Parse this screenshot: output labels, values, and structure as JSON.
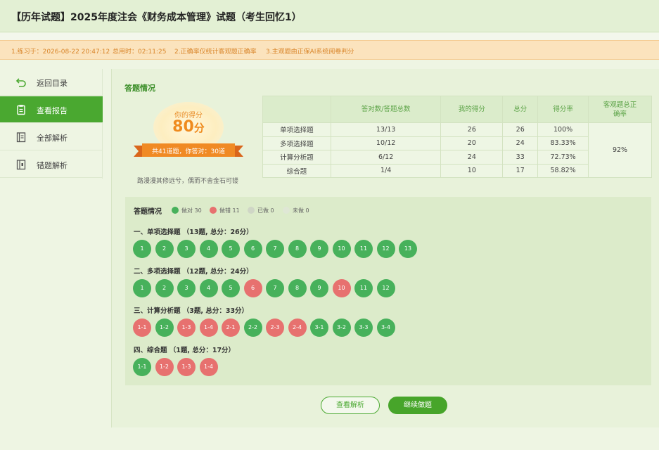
{
  "page": {
    "title": "【历年试题】2025年度注会《财务成本管理》试题（考生回忆1）"
  },
  "info_bar": {
    "practice_time": "1.练习于：2026-08-22 20:47:12",
    "total_time": "总用时：02:11:25",
    "note_accuracy": "2.正确率仅统计客观题正确率",
    "note_grading": "3.主观题由正保AI系统阅卷判分"
  },
  "sidebar": {
    "items": [
      {
        "label": "返回目录",
        "icon": "back-arrow-icon"
      },
      {
        "label": "查看报告",
        "icon": "clipboard-icon",
        "active": true
      },
      {
        "label": "全部解析",
        "icon": "book-icon"
      },
      {
        "label": "错题解析",
        "icon": "notebook-icon"
      }
    ]
  },
  "summary": {
    "section_title": "答题情况",
    "score_caption": "你的得分",
    "score_value": "80",
    "score_unit": "分",
    "score_detail": "共41道题，你答对：30道",
    "motto": "路漫漫其修远兮，偶而不舍金石可镂"
  },
  "stats_table": {
    "headers": [
      "",
      "答对数/答题总数",
      "我的得分",
      "总分",
      "得分率",
      "客观题总正确率"
    ],
    "rows": [
      [
        "单项选择题",
        "13/13",
        "26",
        "26",
        "100%"
      ],
      [
        "多项选择题",
        "10/12",
        "20",
        "24",
        "83.33%"
      ],
      [
        "计算分析题",
        "6/12",
        "24",
        "33",
        "72.73%"
      ],
      [
        "综合题",
        "1/4",
        "10",
        "17",
        "58.82%"
      ]
    ],
    "objective_accuracy": "92%"
  },
  "answer_grid": {
    "title": "答题情况",
    "legend": [
      {
        "label": "做对 30",
        "color": "#47b15b"
      },
      {
        "label": "做错 11",
        "color": "#e7716f"
      },
      {
        "label": "已做 0",
        "color": "#cfd6c6"
      },
      {
        "label": "未做 0",
        "color": "#dfe7d5"
      }
    ],
    "groups": [
      {
        "title": "一、单项选择题 （13题, 总分：26分）",
        "items": [
          {
            "label": "1",
            "status": "right"
          },
          {
            "label": "2",
            "status": "right"
          },
          {
            "label": "3",
            "status": "right"
          },
          {
            "label": "4",
            "status": "right"
          },
          {
            "label": "5",
            "status": "right"
          },
          {
            "label": "6",
            "status": "right"
          },
          {
            "label": "7",
            "status": "right"
          },
          {
            "label": "8",
            "status": "right"
          },
          {
            "label": "9",
            "status": "right"
          },
          {
            "label": "10",
            "status": "right"
          },
          {
            "label": "11",
            "status": "right"
          },
          {
            "label": "12",
            "status": "right"
          },
          {
            "label": "13",
            "status": "right"
          }
        ]
      },
      {
        "title": "二、多项选择题 （12题, 总分：24分）",
        "items": [
          {
            "label": "1",
            "status": "right"
          },
          {
            "label": "2",
            "status": "right"
          },
          {
            "label": "3",
            "status": "right"
          },
          {
            "label": "4",
            "status": "right"
          },
          {
            "label": "5",
            "status": "right"
          },
          {
            "label": "6",
            "status": "wrong"
          },
          {
            "label": "7",
            "status": "right"
          },
          {
            "label": "8",
            "status": "right"
          },
          {
            "label": "9",
            "status": "right"
          },
          {
            "label": "10",
            "status": "wrong"
          },
          {
            "label": "11",
            "status": "right"
          },
          {
            "label": "12",
            "status": "right"
          }
        ]
      },
      {
        "title": "三、计算分析题 （3题, 总分：33分）",
        "items": [
          {
            "label": "1-1",
            "status": "wrong"
          },
          {
            "label": "1-2",
            "status": "right"
          },
          {
            "label": "1-3",
            "status": "wrong"
          },
          {
            "label": "1-4",
            "status": "wrong"
          },
          {
            "label": "2-1",
            "status": "wrong"
          },
          {
            "label": "2-2",
            "status": "right"
          },
          {
            "label": "2-3",
            "status": "wrong"
          },
          {
            "label": "2-4",
            "status": "wrong"
          },
          {
            "label": "3-1",
            "status": "right"
          },
          {
            "label": "3-2",
            "status": "right"
          },
          {
            "label": "3-3",
            "status": "right"
          },
          {
            "label": "3-4",
            "status": "right"
          }
        ]
      },
      {
        "title": "四、综合题 （1题, 总分：17分）",
        "items": [
          {
            "label": "1-1",
            "status": "right"
          },
          {
            "label": "1-2",
            "status": "wrong"
          },
          {
            "label": "1-3",
            "status": "wrong"
          },
          {
            "label": "1-4",
            "status": "wrong"
          }
        ]
      }
    ]
  },
  "actions": {
    "view_analysis": "查看解析",
    "continue_practice": "继续做题"
  },
  "colors": {
    "brand_green": "#47a52a",
    "right": "#47b15b",
    "wrong": "#e7716f",
    "score_orange": "#ef8b1e",
    "info_bg": "#fbe3bd"
  }
}
